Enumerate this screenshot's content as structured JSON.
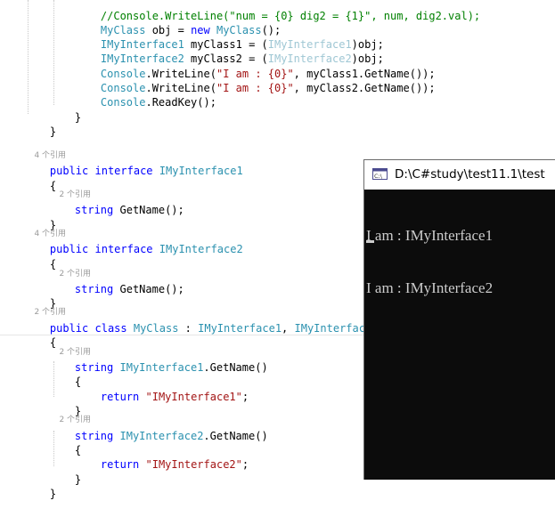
{
  "editor": {
    "lines": {
      "l1_comment": "//Console.WriteLine(\"num = {0} dig2 = {1}\", num, dig2.val);",
      "l2_type": "MyClass",
      "l2_a": " obj = ",
      "l2_kw": "new",
      "l2_b": " ",
      "l2_type2": "MyClass",
      "l2_c": "();",
      "l3_type": "IMyInterface1",
      "l3_a": " myClass1 = (",
      "l3_cast": "IMyInterface1",
      "l3_b": ")obj;",
      "l4_type": "IMyInterface2",
      "l4_a": " myClass2 = (",
      "l4_cast": "IMyInterface2",
      "l4_b": ")obj;",
      "l5_type": "Console",
      "l5_a": ".WriteLine(",
      "l5_str": "\"I am : {0}\"",
      "l5_b": ", myClass1.GetName());",
      "l6_type": "Console",
      "l6_a": ".WriteLine(",
      "l6_str": "\"I am : {0}\"",
      "l6_b": ", myClass2.GetName());",
      "l7_type": "Console",
      "l7_a": ".ReadKey();",
      "close_brace": "}",
      "open_brace": "{",
      "lens_4refs": "4 个引用",
      "lens_2refs": "2 个引用",
      "kw_public": "public",
      "kw_interface": "interface",
      "kw_class": "class",
      "kw_string": "string",
      "kw_return": "return",
      "iface1": "IMyInterface1",
      "iface2": "IMyInterface2",
      "myclass": "MyClass",
      "getname_decl": " GetName();",
      "class_colon": " : ",
      "class_comma": ", ",
      "iface1_getname": ".GetName()",
      "iface2_getname": ".GetName()",
      "ret1_str": "\"IMyInterface1\"",
      "ret2_str": "\"IMyInterface2\"",
      "semicolon": ";"
    }
  },
  "console": {
    "title": "D:\\C#study\\test11.1\\test",
    "icon": "console-app-icon",
    "output": [
      "I am : IMyInterface1",
      "I am : IMyInterface2"
    ]
  },
  "colors": {
    "keyword": "#0000ff",
    "type": "#2b91af",
    "string": "#a31515",
    "comment": "#008000",
    "console_bg": "#0c0c0c",
    "console_text": "#cccccc"
  }
}
